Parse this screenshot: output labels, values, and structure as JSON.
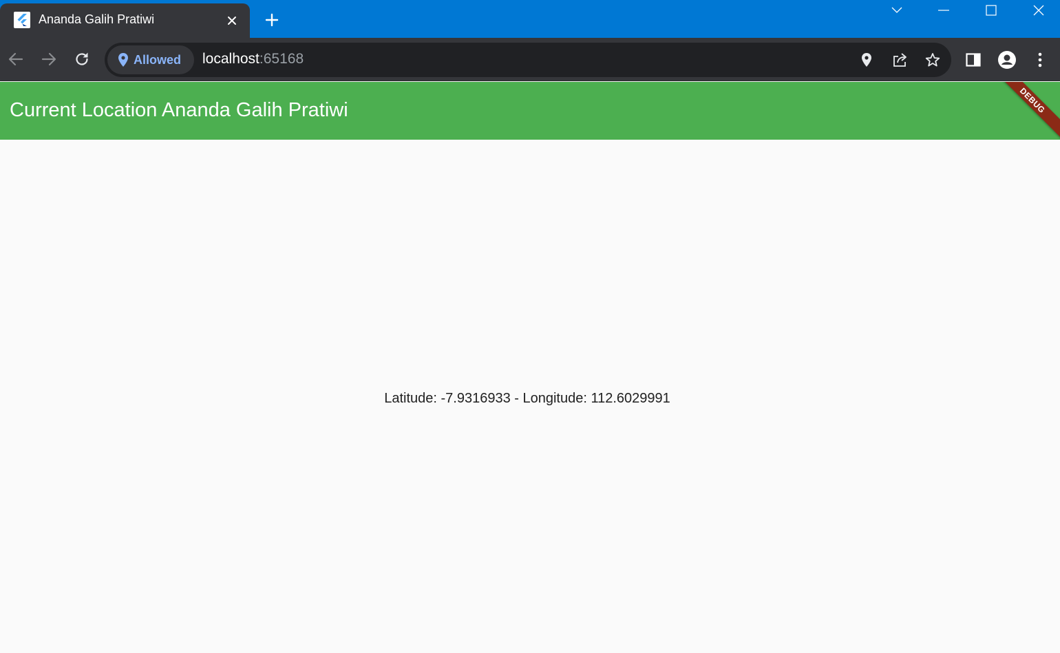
{
  "browser": {
    "tab": {
      "title": "Ananda Galih Pratiwi",
      "favicon": "flutter-icon",
      "close_icon": "close-icon"
    },
    "new_tab_icon": "plus-icon",
    "window_controls": [
      "tab-search-icon",
      "minimize-icon",
      "maximize-icon",
      "close-icon"
    ],
    "toolbar": {
      "back_icon": "back-arrow-icon",
      "forward_icon": "forward-arrow-icon",
      "reload_icon": "reload-icon",
      "permission_chip": {
        "icon": "location-pin-icon",
        "label": "Allowed"
      },
      "url": {
        "host": "localhost",
        "port": ":65168"
      },
      "omnibox_icons": [
        "location-pin-icon",
        "share-icon",
        "star-icon"
      ],
      "right_icons": [
        "side-panel-icon",
        "profile-icon",
        "more-vert-icon"
      ]
    },
    "colors": {
      "tabstrip": "#0078d4",
      "toolbar": "#35363a",
      "omnibox": "#202124",
      "permission_text": "#8ab4f8"
    }
  },
  "app": {
    "appbar": {
      "title": "Current Location Ananda Galih Pratiwi",
      "color": "#4caf50"
    },
    "debug_banner": "DEBUG",
    "location_text": "Latitude: -7.9316933 - Longitude: 112.6029991"
  }
}
